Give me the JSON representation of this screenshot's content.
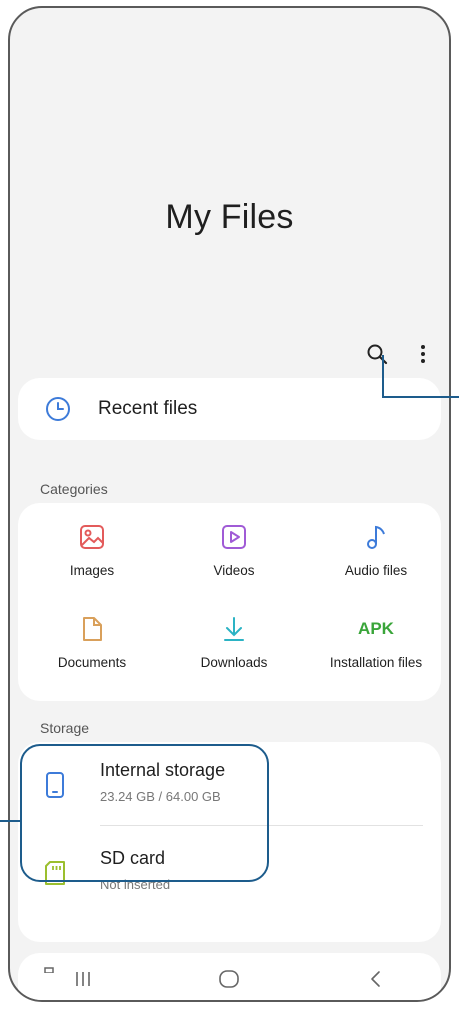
{
  "app": {
    "title": "My Files"
  },
  "toolbar": {
    "search_icon": "search-icon",
    "more_icon": "more-options-icon"
  },
  "recent": {
    "label": "Recent files",
    "icon": "clock-icon"
  },
  "categories": {
    "heading": "Categories",
    "items": [
      {
        "label": "Images",
        "icon": "image-icon",
        "color": "#e35b5b"
      },
      {
        "label": "Videos",
        "icon": "video-icon",
        "color": "#a05bd6"
      },
      {
        "label": "Audio files",
        "icon": "music-note-icon",
        "color": "#3d7bd9"
      },
      {
        "label": "Documents",
        "icon": "document-icon",
        "color": "#d9a05b"
      },
      {
        "label": "Downloads",
        "icon": "download-icon",
        "color": "#2bb3c4"
      },
      {
        "label": "Installation files",
        "icon_text": "APK",
        "color": "#3aa53a"
      }
    ]
  },
  "storage": {
    "heading": "Storage",
    "items": [
      {
        "name": "Internal storage",
        "detail": "23.24 GB / 64.00 GB",
        "icon": "phone-storage-icon",
        "color": "#3d7bd9"
      },
      {
        "name": "SD card",
        "detail": "Not inserted",
        "icon": "sd-card-icon",
        "color": "#9bbf2e"
      }
    ]
  },
  "navbar": {
    "recents": "recent-apps-icon",
    "home": "home-icon",
    "back": "back-icon"
  },
  "accent": "#1d5c8c"
}
